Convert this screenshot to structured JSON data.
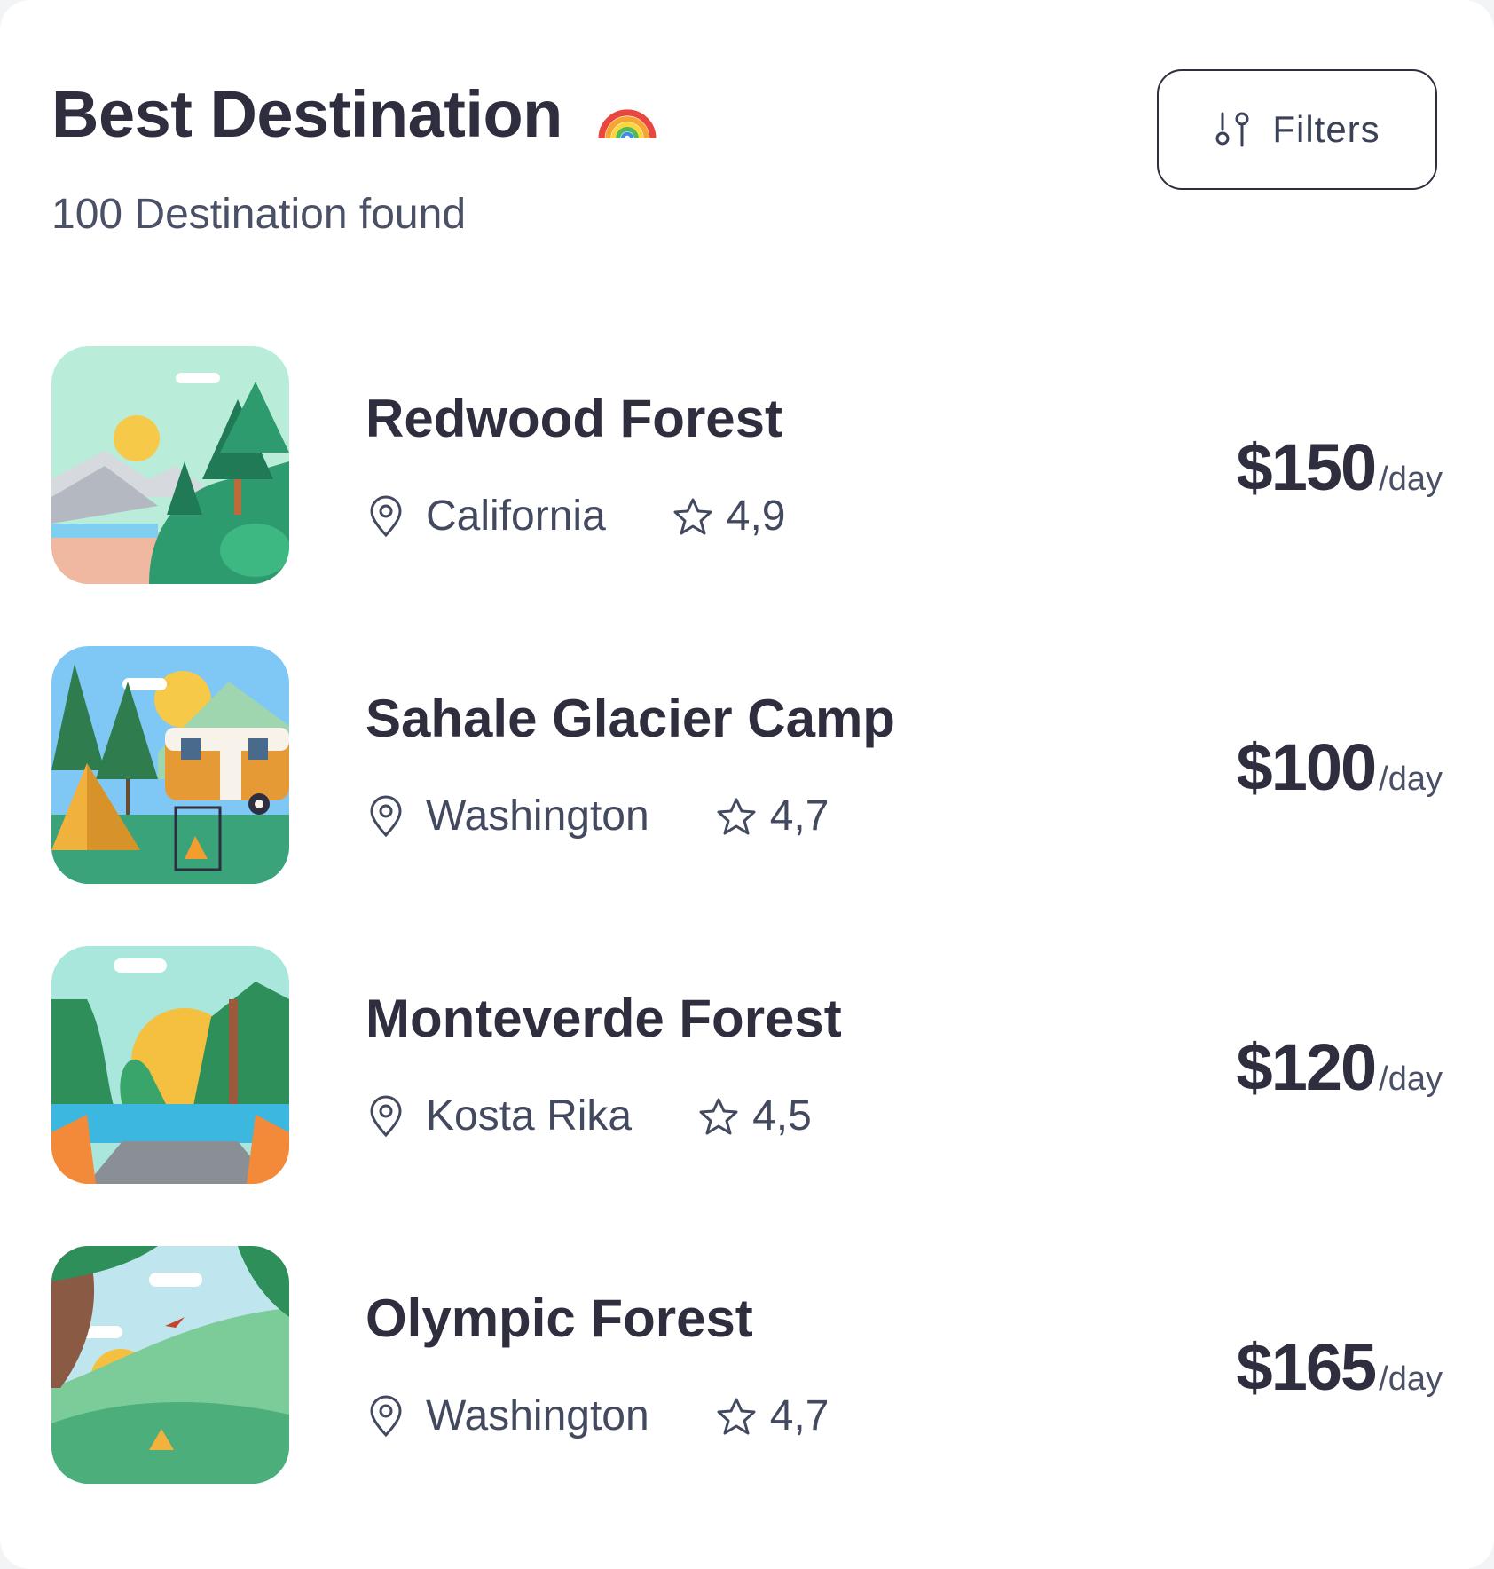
{
  "header": {
    "title": "Best Destination",
    "title_emoji_icon": "rainbow-icon",
    "subtitle": "100 Destination found"
  },
  "filters_button": {
    "label": "Filters",
    "icon": "filter-sliders-icon"
  },
  "colors": {
    "text_dark": "#2e2e3f",
    "text_muted": "#434a60",
    "card_bg": "#ffffff"
  },
  "destinations": [
    {
      "name": "Redwood Forest",
      "location": "California",
      "rating": "4,9",
      "price": "$150",
      "unit": "/day",
      "image": "redwood-forest-illustration"
    },
    {
      "name": "Sahale Glacier Camp",
      "location": "Washington",
      "rating": "4,7",
      "price": "$100",
      "unit": "/day",
      "image": "camping-caravan-illustration"
    },
    {
      "name": "Monteverde Forest",
      "location": "Kosta Rika",
      "rating": "4,5",
      "price": "$120",
      "unit": "/day",
      "image": "lake-forest-sunset-illustration"
    },
    {
      "name": "Olympic Forest",
      "location": "Washington",
      "rating": "4,7",
      "price": "$165",
      "unit": "/day",
      "image": "hills-tent-illustration"
    }
  ]
}
